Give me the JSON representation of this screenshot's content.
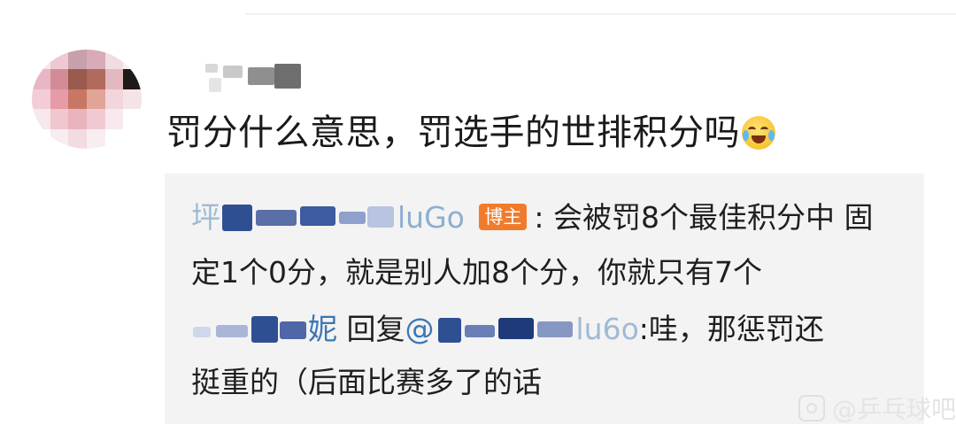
{
  "comment": {
    "author_name": "",
    "text": "罚分什么意思，罚选手的世排积分吗",
    "emoji": "laugh-cry-emoji"
  },
  "replies": [
    {
      "author_visible": "坪",
      "author_suffix": "luGo",
      "badge": "博主",
      "line1": ": 会被罚8个最佳积分中 固",
      "line2": "定1个0分，就是别人加8个分，你就只有7个"
    },
    {
      "author_visible": "妮",
      "reply_word": "回复",
      "mention_at": "@",
      "mention_suffix": "lu6o",
      "line1": ":哇，那惩罚还",
      "line2": "挺重的（后面比赛多了的话"
    }
  ],
  "watermark": {
    "text": "@乒乓球吧"
  }
}
